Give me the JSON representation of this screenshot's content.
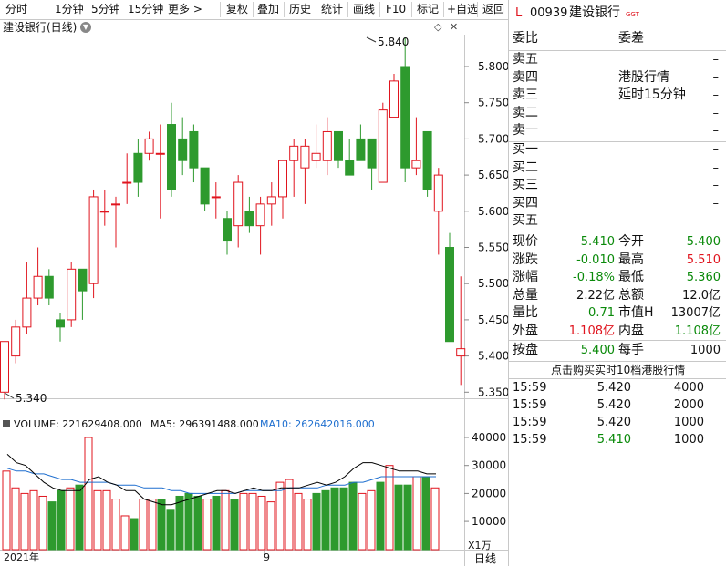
{
  "toolbar": {
    "items": [
      "分时",
      "1分钟",
      "5分钟",
      "15分钟",
      "更多 >",
      "复权",
      "叠加",
      "历史",
      "统计",
      "画线",
      "F10",
      "标记",
      "+自选",
      "返回"
    ]
  },
  "chart": {
    "title": "建设银行(日线)",
    "high_label": "5.840",
    "low_label": "5.340",
    "volume_legend": {
      "volume": "VOLUME: 221629408.000",
      "ma5": "MA5: 296391488.000",
      "ma10": "MA10: 262642016.000"
    },
    "date_labels": [
      "2021年",
      "9"
    ],
    "period_label": "日线",
    "volume_unit": "X1万",
    "colors": {
      "up": "#e0141e",
      "down": "#2e9a2e",
      "ma5": "#000000",
      "ma10": "#1f6fcf"
    }
  },
  "chart_data": {
    "type": "candlestick",
    "price_ticks": [
      "5.800",
      "5.750",
      "5.700",
      "5.650",
      "5.600",
      "5.550",
      "5.500",
      "5.450",
      "5.400",
      "5.350"
    ],
    "volume_ticks": [
      "40000",
      "30000",
      "20000",
      "10000"
    ],
    "price_ylim": [
      5.32,
      5.86
    ],
    "candles": [
      {
        "o": 5.35,
        "h": 5.42,
        "l": 5.34,
        "c": 5.42
      },
      {
        "o": 5.4,
        "h": 5.45,
        "l": 5.39,
        "c": 5.44
      },
      {
        "o": 5.44,
        "h": 5.53,
        "l": 5.43,
        "c": 5.48
      },
      {
        "o": 5.48,
        "h": 5.55,
        "l": 5.47,
        "c": 5.51
      },
      {
        "o": 5.51,
        "h": 5.52,
        "l": 5.47,
        "c": 5.48
      },
      {
        "o": 5.45,
        "h": 5.46,
        "l": 5.42,
        "c": 5.44
      },
      {
        "o": 5.45,
        "h": 5.53,
        "l": 5.44,
        "c": 5.52
      },
      {
        "o": 5.52,
        "h": 5.52,
        "l": 5.45,
        "c": 5.49
      },
      {
        "o": 5.5,
        "h": 5.63,
        "l": 5.48,
        "c": 5.62
      },
      {
        "o": 5.6,
        "h": 5.63,
        "l": 5.58,
        "c": 5.6
      },
      {
        "o": 5.61,
        "h": 5.62,
        "l": 5.55,
        "c": 5.61
      },
      {
        "o": 5.64,
        "h": 5.68,
        "l": 5.61,
        "c": 5.64
      },
      {
        "o": 5.68,
        "h": 5.7,
        "l": 5.62,
        "c": 5.64
      },
      {
        "o": 5.68,
        "h": 5.71,
        "l": 5.67,
        "c": 5.7
      },
      {
        "o": 5.68,
        "h": 5.72,
        "l": 5.59,
        "c": 5.68
      },
      {
        "o": 5.72,
        "h": 5.75,
        "l": 5.62,
        "c": 5.63
      },
      {
        "o": 5.7,
        "h": 5.73,
        "l": 5.65,
        "c": 5.67
      },
      {
        "o": 5.71,
        "h": 5.72,
        "l": 5.64,
        "c": 5.66
      },
      {
        "o": 5.66,
        "h": 5.66,
        "l": 5.6,
        "c": 5.61
      },
      {
        "o": 5.62,
        "h": 5.64,
        "l": 5.59,
        "c": 5.62
      },
      {
        "o": 5.59,
        "h": 5.6,
        "l": 5.54,
        "c": 5.56
      },
      {
        "o": 5.58,
        "h": 5.65,
        "l": 5.55,
        "c": 5.64
      },
      {
        "o": 5.6,
        "h": 5.62,
        "l": 5.57,
        "c": 5.58
      },
      {
        "o": 5.58,
        "h": 5.62,
        "l": 5.54,
        "c": 5.61
      },
      {
        "o": 5.61,
        "h": 5.64,
        "l": 5.58,
        "c": 5.62
      },
      {
        "o": 5.62,
        "h": 5.67,
        "l": 5.59,
        "c": 5.67
      },
      {
        "o": 5.67,
        "h": 5.7,
        "l": 5.62,
        "c": 5.69
      },
      {
        "o": 5.66,
        "h": 5.7,
        "l": 5.61,
        "c": 5.69
      },
      {
        "o": 5.67,
        "h": 5.72,
        "l": 5.66,
        "c": 5.68
      },
      {
        "o": 5.67,
        "h": 5.73,
        "l": 5.65,
        "c": 5.71
      },
      {
        "o": 5.71,
        "h": 5.71,
        "l": 5.66,
        "c": 5.67
      },
      {
        "o": 5.67,
        "h": 5.7,
        "l": 5.65,
        "c": 5.65
      },
      {
        "o": 5.7,
        "h": 5.72,
        "l": 5.68,
        "c": 5.67
      },
      {
        "o": 5.7,
        "h": 5.7,
        "l": 5.63,
        "c": 5.66
      },
      {
        "o": 5.64,
        "h": 5.75,
        "l": 5.64,
        "c": 5.74
      },
      {
        "o": 5.73,
        "h": 5.79,
        "l": 5.73,
        "c": 5.78
      },
      {
        "o": 5.8,
        "h": 5.84,
        "l": 5.64,
        "c": 5.66
      },
      {
        "o": 5.66,
        "h": 5.73,
        "l": 5.65,
        "c": 5.67
      },
      {
        "o": 5.71,
        "h": 5.71,
        "l": 5.62,
        "c": 5.63
      },
      {
        "o": 5.6,
        "h": 5.66,
        "l": 5.54,
        "c": 5.65
      },
      {
        "o": 5.55,
        "h": 5.57,
        "l": 5.42,
        "c": 5.42
      },
      {
        "o": 5.4,
        "h": 5.51,
        "l": 5.36,
        "c": 5.41
      }
    ],
    "volumes": [
      28000,
      22000,
      20000,
      21000,
      19000,
      17000,
      21000,
      22000,
      23000,
      40000,
      21000,
      21000,
      18000,
      12000,
      11000,
      18000,
      18000,
      18000,
      14000,
      19000,
      20000,
      19000,
      18000,
      19000,
      21000,
      18000,
      20000,
      20000,
      19000,
      17000,
      24000,
      25000,
      20000,
      18000,
      20000,
      21000,
      22000,
      22000,
      24000,
      20000,
      21000,
      24000,
      30000,
      23000,
      23000,
      26000,
      26000,
      22000
    ],
    "ma5": [
      34000,
      31000,
      30000,
      27000,
      24000,
      22000,
      21000,
      21000,
      21000,
      25000,
      26000,
      24000,
      23000,
      21000,
      21000,
      18000,
      17000,
      16000,
      16000,
      17000,
      18000,
      19000,
      20000,
      21000,
      21000,
      20000,
      21000,
      22000,
      21000,
      21000,
      22000,
      22000,
      22000,
      23000,
      24000,
      23000,
      24000,
      26000,
      29000,
      31000,
      31000,
      30000,
      29000,
      28000,
      28000,
      28000,
      27000,
      27000
    ],
    "ma10": [
      29000,
      28000,
      28000,
      27000,
      27000,
      26000,
      25000,
      25000,
      24000,
      24000,
      24000,
      24000,
      23000,
      23000,
      23000,
      22000,
      22000,
      22000,
      21000,
      21000,
      20000,
      20000,
      20000,
      20000,
      20000,
      20000,
      21000,
      21000,
      21000,
      21000,
      21000,
      22000,
      22000,
      22000,
      22000,
      23000,
      23000,
      23000,
      24000,
      24000,
      25000,
      26000,
      26000,
      26000,
      26000,
      26000,
      26000,
      26000
    ]
  },
  "quote": {
    "title_code": "00939",
    "title_name": "建设银行",
    "title_badge": "GGT",
    "title_prefix": "L",
    "weibi_label": "委比",
    "weicha_label": "委差",
    "weibi_val": "",
    "weicha_val": "",
    "asks": [
      {
        "label": "卖五",
        "price": "",
        "vol": "–"
      },
      {
        "label": "卖四",
        "price": "港股行情",
        "vol": "–"
      },
      {
        "label": "卖三",
        "price": "延时15分钟",
        "vol": "–"
      },
      {
        "label": "卖二",
        "price": "",
        "vol": "–"
      },
      {
        "label": "卖一",
        "price": "",
        "vol": "–"
      }
    ],
    "bids": [
      {
        "label": "买一",
        "price": "",
        "vol": "–"
      },
      {
        "label": "买二",
        "price": "",
        "vol": "–"
      },
      {
        "label": "买三",
        "price": "",
        "vol": "–"
      },
      {
        "label": "买四",
        "price": "",
        "vol": "–"
      },
      {
        "label": "买五",
        "price": "",
        "vol": "–"
      }
    ],
    "stats": [
      {
        "l1": "现价",
        "v1": "5.410",
        "c1": "green",
        "l2": "今开",
        "v2": "5.400",
        "c2": "green"
      },
      {
        "l1": "涨跌",
        "v1": "-0.010",
        "c1": "green",
        "l2": "最高",
        "v2": "5.510",
        "c2": "red"
      },
      {
        "l1": "涨幅",
        "v1": "-0.18%",
        "c1": "green",
        "l2": "最低",
        "v2": "5.360",
        "c2": "green"
      },
      {
        "l1": "总量",
        "v1": "2.22亿",
        "c1": "",
        "l2": "总额",
        "v2": "12.0亿",
        "c2": ""
      },
      {
        "l1": "量比",
        "v1": "0.71",
        "c1": "green",
        "l2": "市值H",
        "v2": "13007亿",
        "c2": ""
      },
      {
        "l1": "外盘",
        "v1": "1.108亿",
        "c1": "red",
        "l2": "内盘",
        "v2": "1.108亿",
        "c2": "green"
      }
    ],
    "bid_ask": {
      "l1": "按盘",
      "v1": "5.400",
      "l2": "每手",
      "v2": "1000"
    },
    "promo": "点击购买实时10档港股行情",
    "ticks": [
      {
        "time": "15:59",
        "price": "5.420",
        "price_color": "",
        "vol": "4000"
      },
      {
        "time": "15:59",
        "price": "5.420",
        "price_color": "",
        "vol": "2000"
      },
      {
        "time": "15:59",
        "price": "5.420",
        "price_color": "",
        "vol": "1000"
      },
      {
        "time": "15:59",
        "price": "5.410",
        "price_color": "green",
        "vol": "1000"
      }
    ]
  }
}
